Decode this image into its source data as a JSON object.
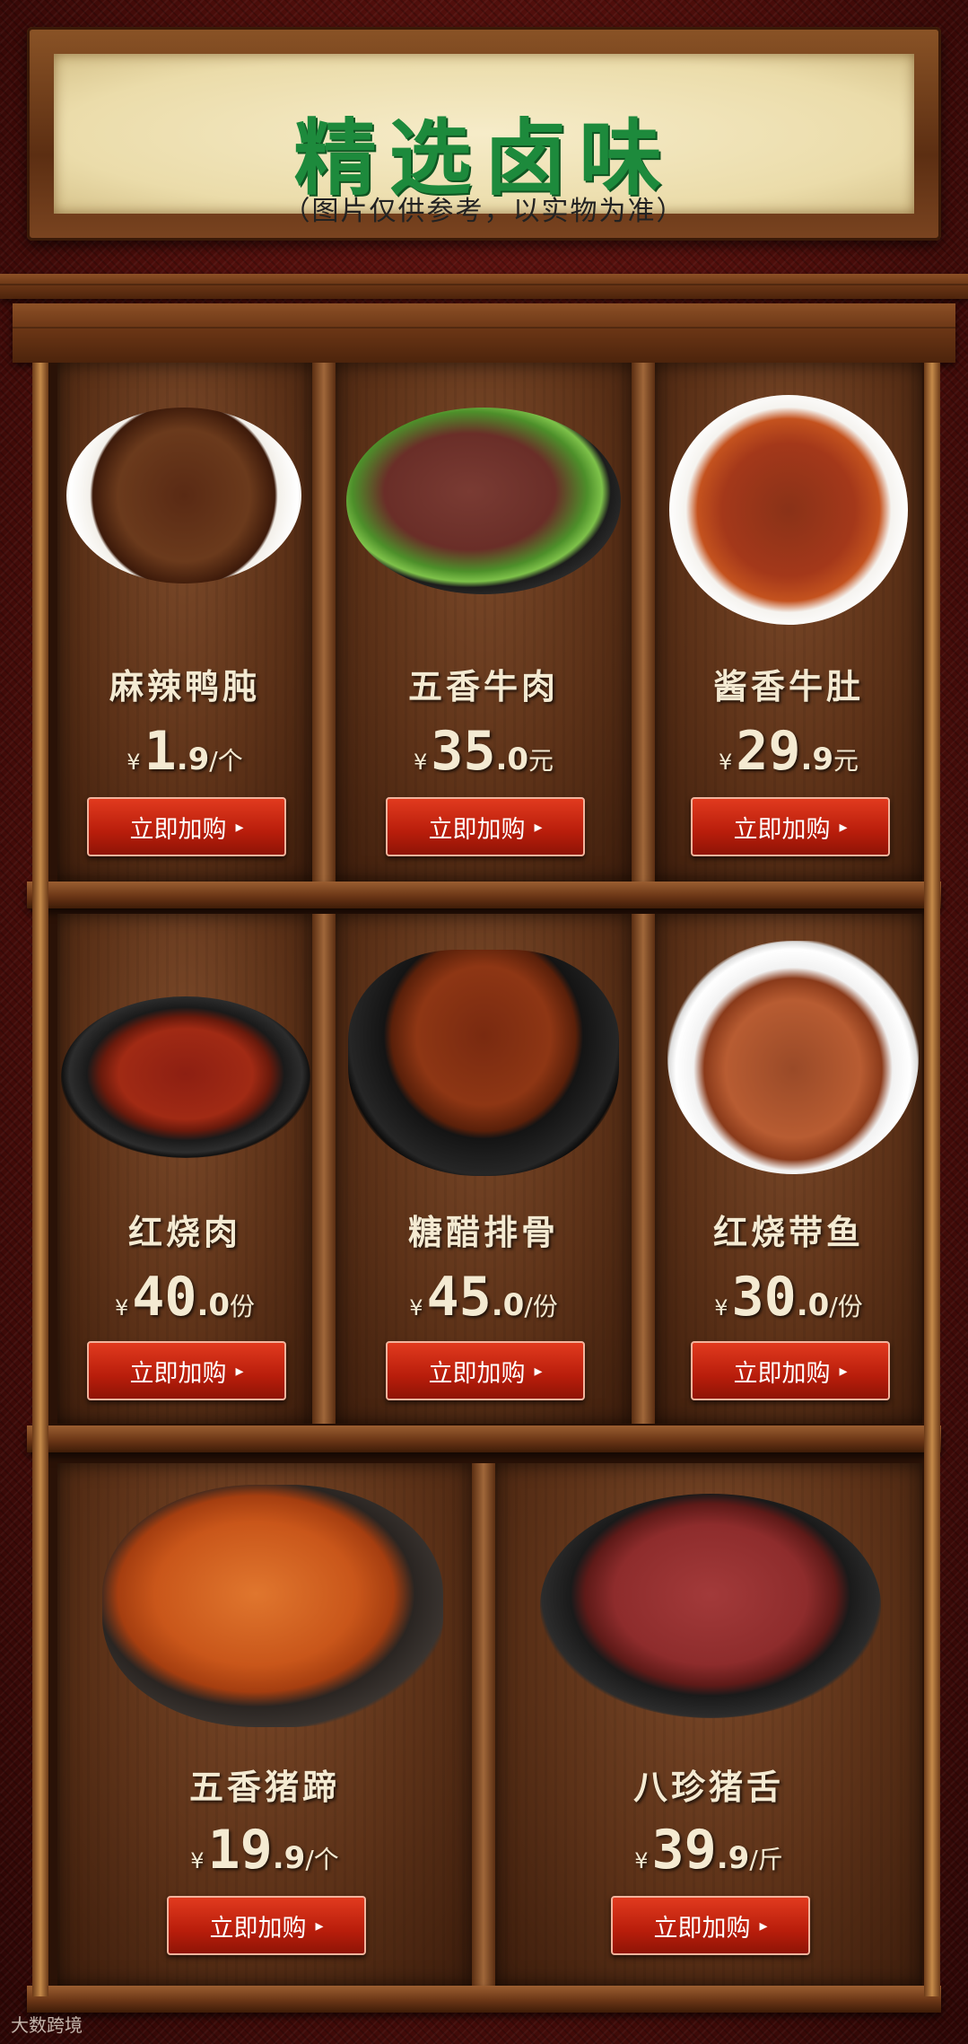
{
  "header": {
    "title": "精选卤味",
    "subtitle": "（图片仅供参考，以实物为准）"
  },
  "rows": [
    [
      {
        "name": "麻辣鸭肫",
        "price_int": "1",
        "price_dec": ".9",
        "unit": "/个",
        "button": "立即加购",
        "icon": "duck-gizzard-dish-icon"
      },
      {
        "name": "五香牛肉",
        "price_int": "35",
        "price_dec": ".0",
        "unit": "元",
        "button": "立即加购",
        "icon": "spiced-beef-dish-icon"
      },
      {
        "name": "酱香牛肚",
        "price_int": "29",
        "price_dec": ".9",
        "unit": "元",
        "button": "立即加购",
        "icon": "beef-tripe-dish-icon"
      }
    ],
    [
      {
        "name": "红烧肉",
        "price_int": "40",
        "price_dec": ".0",
        "unit": "份",
        "button": "立即加购",
        "icon": "braised-pork-dish-icon"
      },
      {
        "name": "糖醋排骨",
        "price_int": "45",
        "price_dec": ".0",
        "unit": "/份",
        "button": "立即加购",
        "icon": "spare-ribs-dish-icon"
      },
      {
        "name": "红烧带鱼",
        "price_int": "30",
        "price_dec": ".0",
        "unit": "/份",
        "button": "立即加购",
        "icon": "hairtail-fish-dish-icon"
      }
    ],
    [
      {
        "name": "五香猪蹄",
        "price_int": "19",
        "price_dec": ".9",
        "unit": "/个",
        "button": "立即加购",
        "icon": "pig-trotter-dish-icon"
      },
      {
        "name": "八珍猪舌",
        "price_int": "39",
        "price_dec": ".9",
        "unit": "/斤",
        "button": "立即加购",
        "icon": "pork-tongue-dish-icon"
      }
    ]
  ],
  "currency": "¥",
  "button_arrow": "▸",
  "watermark": "大数跨境",
  "colors": {
    "title_green": "#1d8a3c",
    "button_red": "#c8250f",
    "wood": "#6a3515"
  }
}
